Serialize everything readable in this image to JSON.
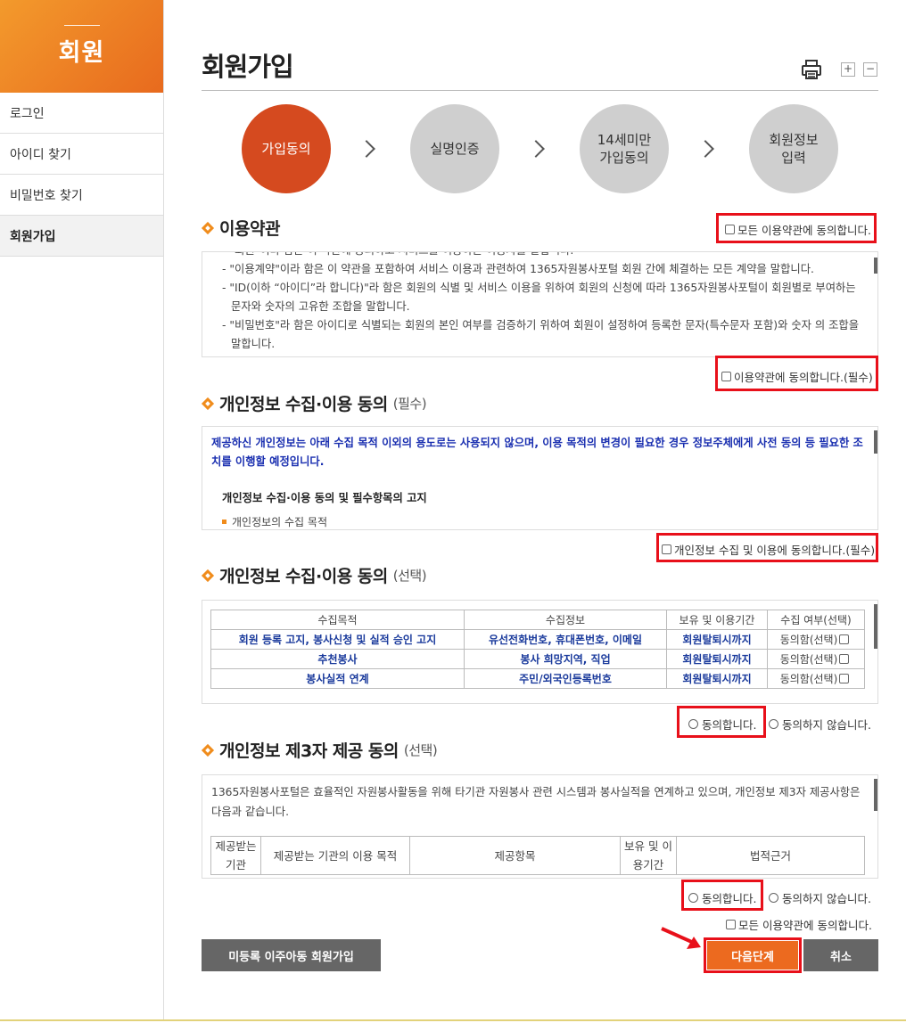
{
  "sidebar": {
    "title": "회원",
    "items": [
      {
        "label": "로그인"
      },
      {
        "label": "아이디 찾기"
      },
      {
        "label": "비밀번호 찾기"
      },
      {
        "label": "회원가입",
        "active": true
      }
    ]
  },
  "header": {
    "title": "회원가입",
    "print_icon": "printer-icon",
    "zoom_in": "+",
    "zoom_out": "−"
  },
  "steps": [
    {
      "label": "가입동의",
      "active": true
    },
    {
      "label": "실명인증"
    },
    {
      "label": "14세미만\n가입동의"
    },
    {
      "label": "회원정보\n입력"
    }
  ],
  "terms": {
    "title": "이용약관",
    "agree_all_label": "모든 이용약관에 동의합니다.",
    "cut_line": "- \"회원\"이라 함은 이 약관에 동의하고 서비스를 이용하는 이용자를 말합니다.",
    "lines": [
      "- \"이용계약\"이라 함은 이 약관을 포함하여 서비스 이용과 관련하여 1365자원봉사포털 회원 간에 체결하는 모든 계약을 말합니다.",
      "- \"ID(이하 “아이디”라 합니다)\"라 함은 회원의 식별 및 서비스 이용을 위하여 회원의 신청에 따라 1365자원봉사포털이 회원별로 부여하는 문자와 숫자의 고유한 조합을 말합니다.",
      "- \"비밀번호\"라 함은 아이디로 식별되는 회원의 본인 여부를 검증하기 위하여 회원이 설정하여 등록한 문자(특수문자 포함)와 숫자 의 조합을 말합니다."
    ],
    "agree_label": "이용약관에 동의합니다.(필수)"
  },
  "privacy_required": {
    "title": "개인정보 수집·이용 동의",
    "tag": "(필수)",
    "notice": "제공하신 개인정보는 아래 수집 목적 이외의 용도로는 사용되지 않으며, 이용 목적의 변경이 필요한 경우 정보주체에게 사전 동의 등 필요한 조치를 이행할 예정입니다.",
    "subheading": "개인정보 수집·이용 동의 및 필수항목의 고지",
    "cut_item": "개인정보의 수집 목적",
    "agree_label": "개인정보 수집 및 이용에 동의합니다.(필수)"
  },
  "privacy_optional": {
    "title": "개인정보 수집·이용 동의",
    "tag": "(선택)",
    "columns": [
      "수집목적",
      "수집정보",
      "보유 및 이용기간",
      "수집 여부(선택)"
    ],
    "rows": [
      {
        "purpose": "회원 등록 고지, 봉사신청 및 실적 승인 고지",
        "info": "유선전화번호, 휴대폰번호, 이메일",
        "period": "회원탈퇴시까지",
        "consent": "동의함(선택)"
      },
      {
        "purpose": "추천봉사",
        "info": "봉사 희망지역, 직업",
        "period": "회원탈퇴시까지",
        "consent": "동의함(선택)"
      },
      {
        "purpose": "봉사실적 연계",
        "info": "주민/외국인등록번호",
        "period": "회원탈퇴시까지",
        "consent": "동의함(선택)"
      }
    ],
    "agree_label": "동의합니다.",
    "disagree_label": "동의하지 않습니다."
  },
  "third_party": {
    "title": "개인정보 제3자 제공 동의",
    "tag": "(선택)",
    "notice": "1365자원봉사포털은 효율적인 자원봉사활동을 위해 타기관 자원봉사 관련 시스템과 봉사실적을 연계하고 있으며, 개인정보 제3자 제공사항은 다음과 같습니다.",
    "columns": [
      "제공받는 기관",
      "제공받는 기관의 이용 목적",
      "제공항목",
      "보유 및 이용기간",
      "법적근거"
    ],
    "agree_label": "동의합니다.",
    "disagree_label": "동의하지 않습니다.",
    "agree_all_label": "모든 이용약관에 동의합니다."
  },
  "buttons": {
    "unregistered": "미등록 이주아동 회원가입",
    "next": "다음단계",
    "cancel": "취소"
  },
  "colors": {
    "accent": "#e8641e",
    "step_active": "#d54a1f",
    "highlight": "#e8101a",
    "button_dark": "#666666"
  }
}
